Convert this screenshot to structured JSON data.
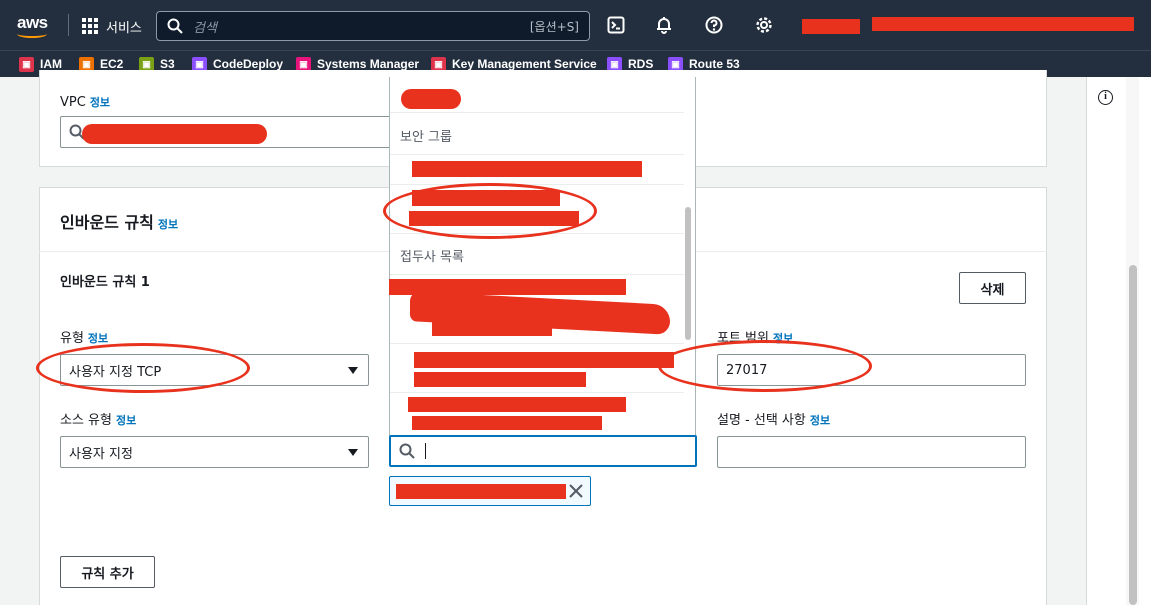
{
  "topnav": {
    "logo": "aws",
    "services_label": "서비스",
    "search_placeholder": "검색",
    "search_shortcut": "[옵션+S]",
    "icons": [
      "cloudshell-icon",
      "bell-icon",
      "help-icon",
      "gear-icon"
    ]
  },
  "favorites": [
    {
      "label": "IAM",
      "color": "#dd344c"
    },
    {
      "label": "EC2",
      "color": "#ed7100"
    },
    {
      "label": "S3",
      "color": "#7aa116"
    },
    {
      "label": "CodeDeploy",
      "color": "#8c4fff"
    },
    {
      "label": "Systems Manager",
      "color": "#e7157b"
    },
    {
      "label": "Key Management Service",
      "color": "#dd344c"
    },
    {
      "label": "RDS",
      "color": "#8c4fff"
    },
    {
      "label": "Route 53",
      "color": "#8c4fff"
    }
  ],
  "vpc": {
    "label": "VPC",
    "info": "정보"
  },
  "inbound": {
    "title": "인바운드 규칙",
    "info": "정보",
    "rule_title": "인바운드 규칙 1",
    "delete_button": "삭제",
    "type_label": "유형",
    "type_info": "정보",
    "type_value": "사용자 지정 TCP",
    "source_type_label": "소스 유형",
    "source_type_info": "정보",
    "source_type_value": "사용자 지정",
    "port_label": "포트 범위",
    "port_info": "정보",
    "port_value": "27017",
    "desc_label": "설명 - 선택 사항",
    "desc_info": "정보",
    "desc_value": "",
    "add_rule_button": "규칙 추가"
  },
  "dropdown": {
    "group_security": "보안 그룹",
    "group_prefix": "접두사 목록",
    "search_value": ""
  },
  "colors": {
    "nav_bg": "#232f3e",
    "link": "#0073bb",
    "annotation": "#e8321e",
    "aws_orange": "#ff9900"
  }
}
